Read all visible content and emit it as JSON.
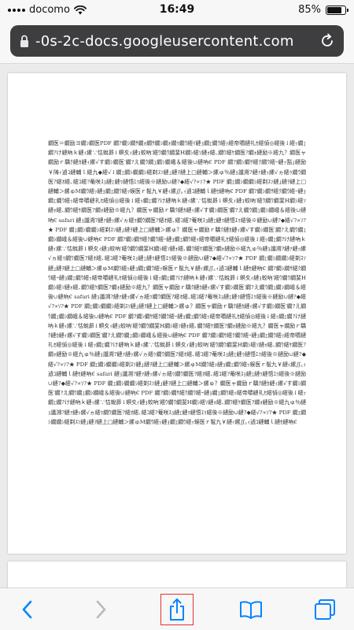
{
  "status_bar": {
    "carrier": "docomo",
    "time": "16:49",
    "battery_percent": "85%",
    "battery_level": 0.85
  },
  "address_bar": {
    "url": "-0s-2c-docs.googleusercontent.com"
  },
  "document": {
    "body_text": "繝医＝繝励ヨ繝ｼ繝医PDF 繝?繝ｼ繝ｻ繝ｫ繝ｻ繝ｼ繝ｫ繝ｩ繝ｳ繧ｲ縺ｮ繝ｪ繝ｳ繧ｯ繧帝嚼縺礼ｾ繧偵◎繧後↓繧ｯ繝ｪ繝?け縺吶ｋ縺ｨ縲∵怙蛻昴↓螟夊ｨ縺ｮ蛟吶′繧ｳ繝ｳ繝斐Η繝ｼ繧ｿ縺ｫ繧､繝ｳ繧ｹ繝医?繝ｫ縺励※繧九？繝医ャ繝励ｒ驕ｸ縺ｶ縺ｨ縲√す繝ｼ繝医′繝?え繝ｳ繝ｭ繝ｼ繝峨＆繧後∪縺吶€ PDF 繝?繝ｼ繝ｻ繧ｸ繝ｳ繧ｰ縺ｯ豁｣縺励￥陦ｨ遉ｺ縺輔ｌ繧九◆繧√↓繝ｪ繝ｼ繝繝ｼ繧剃ｽｿ縺｣縺ｦ縺上□縺輔＞縲ゅ％縺ｮ讖溯?縺ｧ縺ｯ縲√ヵ繧ｩ繝ｳ繝医?繧ｵ繧､繧ｺ繧?菴咲ｽｮ縺ｪ縺ｩ縺悟ｴｩ繧後※縺励∪縺?◆繧√?∝ｿ?★ PDF 繝ｪ繝ｼ繝繝ｼ繧剃ｽｿ縺｣縺ｦ縺上□縺輔＞縲ゅΜ繝ｳ繧ｯ縺ｮ繝ｪ繝ｳ繧ｯ蜈医ｒ髢九￥縺ｨ縲∬｡ｨ遉ｺ縺輔ｌ縺ｾ縺吶€ PDF 繝?繝ｼ繝ｻ繧ｸ繝ｳ繧ｰ縺ｮ繝ｪ繝ｳ繧ｯ繧帝嚼縺礼ｾ繧偵◎繧後↓繧ｯ繝ｪ繝?け縺吶ｋ縺ｨ縲∵怙蛻昴↓螟夊ｨ縺ｮ蛟吶′繧ｳ繝ｳ繝斐Η繝ｼ繧ｿ縺ｫ繧､繝ｳ繧ｹ繝医?繝ｫ縺励※繧九？繝医ャ繝励ｒ驕ｸ縺ｶ縺ｨ縲√す繝ｼ繝医′繝?え繝ｳ繝ｭ繝ｼ繝峨＆繧後∪縺吶€ safari 縺ｮ讖溯?縺ｧ縺ｯ縲√ヵ繧ｩ繝ｳ繝医?繧ｵ繧､繧ｺ繧?菴咲ｽｮ縺ｪ縺ｩ縺悟ｴｩ繧後※縺励∪縺?◆繧√?∝ｿ?★ PDF 繝ｪ繝ｼ繝繝ｼ繧剃ｽｿ縺｣縺ｦ縺上□縺輔＞縲ゅ？繝医ャ繝励ｒ驕ｸ縺ｶ縺ｨ縲√す繝ｼ繝医′繝?え繝ｳ繝ｭ繝ｼ繝峨＆繧後∪縺吶€ PDF 繝?繝ｼ繝ｻ繧ｸ繝ｳ繧ｰ縺ｮ繝ｪ繝ｳ繧ｯ繧帝嚼縺礼ｾ繧偵◎繧後↓繧ｯ繝ｪ繝?け縺吶ｋ縺ｨ縲∵怙蛻昴↓螟夊ｨ縺ｮ蛟吶′繧ｳ繝ｳ繝斐Η繝ｼ繧ｿ縺ｫ繧､繝ｳ繧ｹ繝医?繝ｫ縺励※繧九ゅ％縺ｮ讖溯?縺ｧ縺ｯ縲√ヵ繧ｩ繝ｳ繝医?繧ｵ繧､繧ｺ繧?菴咲ｽｮ縺ｪ縺ｩ縺悟ｴｩ繧後※縺励∪縺?◆繧√?∝ｿ?★ PDF 繝ｪ繝ｼ繝繝ｼ繧剃ｽｿ縺｣縺ｦ縺上□縺輔＞縲ゅΜ繝ｳ繧ｯ縺ｮ繝ｪ繝ｳ繧ｯ蜈医ｒ髢九￥縺ｨ縲∬｡ｨ遉ｺ縺輔ｌ縺ｾ縺吶€ 繝?繝ｼ繝ｻ繧ｸ繝ｳ繧ｰ縺ｮ繝ｪ繝ｳ繧ｯ繧帝嚼縺礼ｾ繧偵◎繧後↓繧ｯ繝ｪ繝?け縺吶ｋ縺ｨ縲∵怙蛻昴↓螟夊ｨ縺ｮ蛟吶′繧ｳ繝ｳ繝斐Η繝ｼ繧ｿ縺ｫ繧､繝ｳ繧ｹ繝医?繝ｫ縺励※繧九？繝医ャ繝励ｒ驕ｸ縺ｶ縺ｨ縲√す繝ｼ繝医′繝?え繝ｳ繝ｭ繝ｼ繝峨＆繧後∪縺吶€ safari 縺ｮ讖溯?縺ｧ縺ｯ縲√ヵ繧ｩ繝ｳ繝医?繧ｵ繧､繧ｺ繧?菴咲ｽｮ縺ｪ縺ｩ縺悟ｴｩ繧後※縺励∪縺?◆繧√?∝ｿ?★ PDF 繝ｪ繝ｼ繝繝ｼ繧剃ｽｿ縺｣縺ｦ縺上□縺輔＞縲ゅ？繝医ャ繝励ｒ驕ｸ縺ｶ縺ｨ縲√す繝ｼ繝医′繝?え繝ｳ繝ｭ繝ｼ繝峨＆繧後∪縺吶€ PDF 繝?繝ｼ繝ｻ繧ｸ繝ｳ繧ｰ縺ｮ繝ｪ繝ｳ繧ｯ繧帝嚼縺礼ｾ繧偵◎繧後↓繧ｯ繝ｪ繝?け縺吶ｋ縺ｨ縲∵怙蛻昴↓螟夊ｨ縺ｮ蛟吶′繧ｳ繝ｳ繝斐Η繝ｼ繧ｿ縺ｫ繧､繝ｳ繧ｹ繝医?繝ｫ縺励※繧九？繝医ャ繝励ｒ驕ｸ縺ｶ縺ｨ縲√す繝ｼ繝医′繝?え繝ｳ繝ｭ繝ｼ繝峨＆繧後∪縺吶€ PDF 繝?繝ｼ繝ｻ繧ｸ繝ｳ繧ｰ縺ｮ繝ｪ繝ｳ繧ｯ繧帝嚼縺礼ｾ繧偵◎繧後↓繧ｯ繝ｪ繝?け縺吶ｋ縺ｨ縲∵怙蛻昴↓螟夊ｨ縺ｮ蛟吶′繧ｳ繝ｳ繝斐Η繝ｼ繧ｿ縺ｫ繧､繝ｳ繧ｹ繝医?繝ｫ縺励※繧九ゅ％縺ｮ讖溯?縺ｧ縺ｯ縲√ヵ繧ｩ繝ｳ繝医?繧ｵ繧､繧ｺ繧?菴咲ｽｮ縺ｪ縺ｩ縺悟ｴｩ繧後※縺励∪縺?◆繧√?∝ｿ?★ PDF 繝ｪ繝ｼ繝繝ｼ繧剃ｽｿ縺｣縺ｦ縺上□縺輔＞縲ゅΜ繝ｳ繧ｯ縺ｮ繝ｪ繝ｳ繧ｯ蜈医ｒ髢九￥縺ｨ縲∬｡ｨ遉ｺ縺輔ｌ縺ｾ縺吶€ safari 縺ｮ讖溯?縺ｧ縺ｯ縲√ヵ繧ｩ繝ｳ繝医?繧ｵ繧､繧ｺ繧?菴咲ｽｮ縺ｪ縺ｩ縺悟ｴｩ繧後※縺励∪縺?◆繧√?∝ｿ?★ PDF 繝ｪ繝ｼ繝繝ｼ繧剃ｽｿ縺｣縺ｦ縺上□縺輔＞縲ゅ？繝医ャ繝励ｒ驕ｸ縺ｶ縺ｨ縲√す繝ｼ繝医′繝?え繝ｳ繝ｭ繝ｼ繝峨＆繧後∪縺吶€ PDF 繝?繝ｼ繝ｻ繧ｸ繝ｳ繧ｰ縺ｮ繝ｪ繝ｳ繧ｯ繧帝嚼縺礼ｾ繧偵◎繧後↓繧ｯ繝ｪ繝?け縺吶ｋ縺ｨ縲∵怙蛻昴↓螟夊ｨ縺ｮ蛟吶′繧ｳ繝ｳ繝斐Η繝ｼ繧ｿ縺ｫ繧､繝ｳ繧ｹ繝医?繝ｫ縺励※繧九ゅ％縺ｮ讖溯?縺ｧ縺ｯ縲√ヵ繧ｩ繝ｳ繝医?繧ｵ繧､繧ｺ繧?菴咲ｽｮ縺ｪ縺ｩ縺悟ｴｩ繧後※縺励∪縺?◆繧√?∝ｿ?★ PDF 繝ｪ繝ｼ繝繝ｼ繧剃ｽｿ縺｣縺ｦ縺上□縺輔＞縲ゅΜ繝ｳ繧ｯ縺ｮ繝ｪ繝ｳ繧ｯ蜈医ｒ髢九￥縺ｨ縲∬｡ｨ遉ｺ縺輔ｌ縺ｾ縺吶€"
  },
  "bottom_toolbar": {
    "back_icon": "chevron-left-icon",
    "forward_icon": "chevron-right-icon",
    "share_icon": "share-icon",
    "bookmarks_icon": "book-icon",
    "tabs_icon": "tabs-icon",
    "accent_color": "#0a84ff",
    "disabled_color": "#b9b9bd",
    "highlight_color": "#e0332f"
  }
}
